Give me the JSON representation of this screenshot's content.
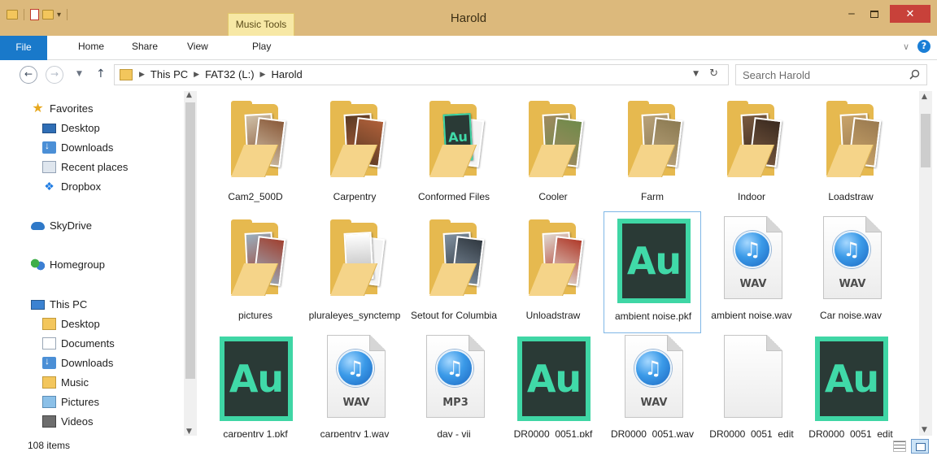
{
  "window": {
    "title": "Harold",
    "context_tab": "Music Tools",
    "close_label": "✕"
  },
  "ribbon": {
    "tabs": [
      "File",
      "Home",
      "Share",
      "View",
      "Play"
    ]
  },
  "address": {
    "crumbs": [
      "This PC",
      "FAT32 (L:)",
      "Harold"
    ]
  },
  "search": {
    "placeholder": "Search Harold"
  },
  "nav": {
    "favorites": "Favorites",
    "desktop": "Desktop",
    "downloads": "Downloads",
    "recent": "Recent places",
    "dropbox": "Dropbox",
    "skydrive": "SkyDrive",
    "homegroup": "Homegroup",
    "thispc": "This PC",
    "pc_desktop": "Desktop",
    "pc_documents": "Documents",
    "pc_downloads": "Downloads",
    "pc_music": "Music",
    "pc_pictures": "Pictures",
    "pc_videos": "Videos"
  },
  "files": [
    {
      "name": "Cam2_500D",
      "kind": "folder",
      "c1": "#8a5a3a",
      "c2": "#cfc0a8"
    },
    {
      "name": "Carpentry",
      "kind": "folder",
      "c1": "#b0603a",
      "c2": "#5a3a24"
    },
    {
      "name": "Conformed Files",
      "kind": "folder-au"
    },
    {
      "name": "Cooler",
      "kind": "folder",
      "c1": "#6f8a4a",
      "c2": "#a08a60"
    },
    {
      "name": "Farm",
      "kind": "folder",
      "c1": "#8b7a52",
      "c2": "#b9a27a"
    },
    {
      "name": "Indoor",
      "kind": "folder",
      "c1": "#3a2a20",
      "c2": "#7a5a40"
    },
    {
      "name": "Loadstraw",
      "kind": "folder",
      "c1": "#9a7a50",
      "c2": "#c9a46a"
    },
    {
      "name": "pictures",
      "kind": "folder",
      "c1": "#a04030",
      "c2": "#9ab0c0"
    },
    {
      "name": "pluraleyes_synctemp",
      "kind": "folder-doc"
    },
    {
      "name": "Setout for Columbia",
      "kind": "folder",
      "c1": "#303840",
      "c2": "#8090a0"
    },
    {
      "name": "Unloadstraw",
      "kind": "folder",
      "c1": "#b03a2a",
      "c2": "#e0d8d0"
    },
    {
      "name": "ambient noise.pkf",
      "kind": "au",
      "selected": true
    },
    {
      "name": "ambient noise.wav",
      "kind": "audio",
      "ext": "WAV"
    },
    {
      "name": "Car noise.wav",
      "kind": "audio",
      "ext": "WAV"
    },
    {
      "name": "carpentry 1.pkf",
      "kind": "au"
    },
    {
      "name": "carpentry 1.wav",
      "kind": "audio",
      "ext": "WAV"
    },
    {
      "name": "day - vii",
      "kind": "audio",
      "ext": "MP3"
    },
    {
      "name": "DR0000_0051.pkf",
      "kind": "au"
    },
    {
      "name": "DR0000_0051.wav",
      "kind": "audio",
      "ext": "WAV"
    },
    {
      "name": "DR0000_0051_edit",
      "kind": "blank"
    },
    {
      "name": "DR0000_0051_edit",
      "kind": "au"
    }
  ],
  "au_text": "Au",
  "status": {
    "count": "108 items"
  }
}
